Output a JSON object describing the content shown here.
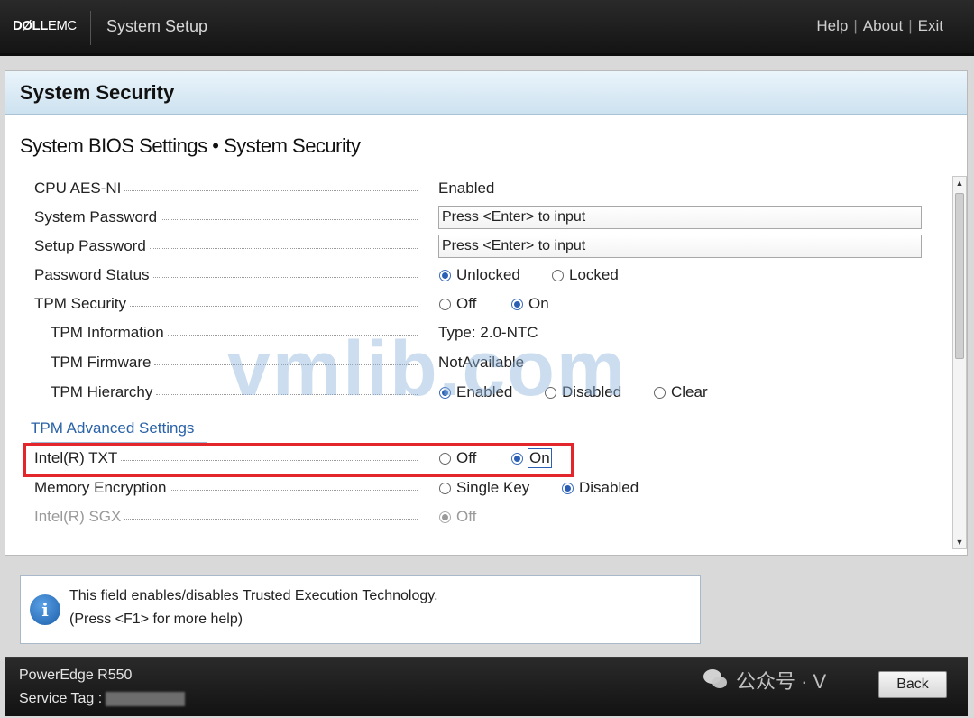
{
  "header": {
    "brand_dell": "DØLL",
    "brand_emc": "EMC",
    "title": "System Setup",
    "links": [
      "Help",
      "About",
      "Exit"
    ]
  },
  "panel": {
    "title": "System Security",
    "breadcrumb": "System BIOS Settings • System Security"
  },
  "settings": [
    {
      "label": "CPU AES-NI",
      "value": "Enabled"
    },
    {
      "label": "System Password",
      "input": "Press <Enter> to input"
    },
    {
      "label": "Setup Password",
      "input": "Press <Enter> to input"
    },
    {
      "label": "Password Status",
      "options": [
        "Unlocked",
        "Locked"
      ],
      "selected": "Unlocked"
    },
    {
      "label": "TPM Security",
      "options": [
        "Off",
        "On"
      ],
      "selected": "On"
    },
    {
      "label": "TPM Information",
      "value": "Type: 2.0-NTC"
    },
    {
      "label": "TPM Firmware",
      "value": "NotAvailable"
    },
    {
      "label": "TPM Hierarchy",
      "options": [
        "Enabled",
        "Disabled",
        "Clear"
      ],
      "selected": "Enabled"
    },
    {
      "label": "Intel(R) TXT",
      "options": [
        "Off",
        "On"
      ],
      "selected": "On"
    },
    {
      "label": "Memory Encryption",
      "options": [
        "Single Key",
        "Disabled"
      ],
      "selected": "Disabled"
    },
    {
      "label": "Intel(R) SGX",
      "options": [
        "Off"
      ],
      "selected": "Off",
      "disabled": true
    }
  ],
  "subsection": "TPM Advanced Settings",
  "help": {
    "line1": "This field enables/disables Trusted Execution Technology.",
    "line2": "(Press <F1> for more help)"
  },
  "footer": {
    "model": "PowerEdge R550",
    "service_tag_label": "Service Tag :",
    "back_label": "Back"
  },
  "watermarks": {
    "site": "vmlib.com",
    "social": "公众号 · V"
  },
  "colors": {
    "accent": "#2b5fb5",
    "highlight": "#e2262b",
    "header_bg": "#1f1f1f",
    "panel_header": "#cde2f0"
  }
}
